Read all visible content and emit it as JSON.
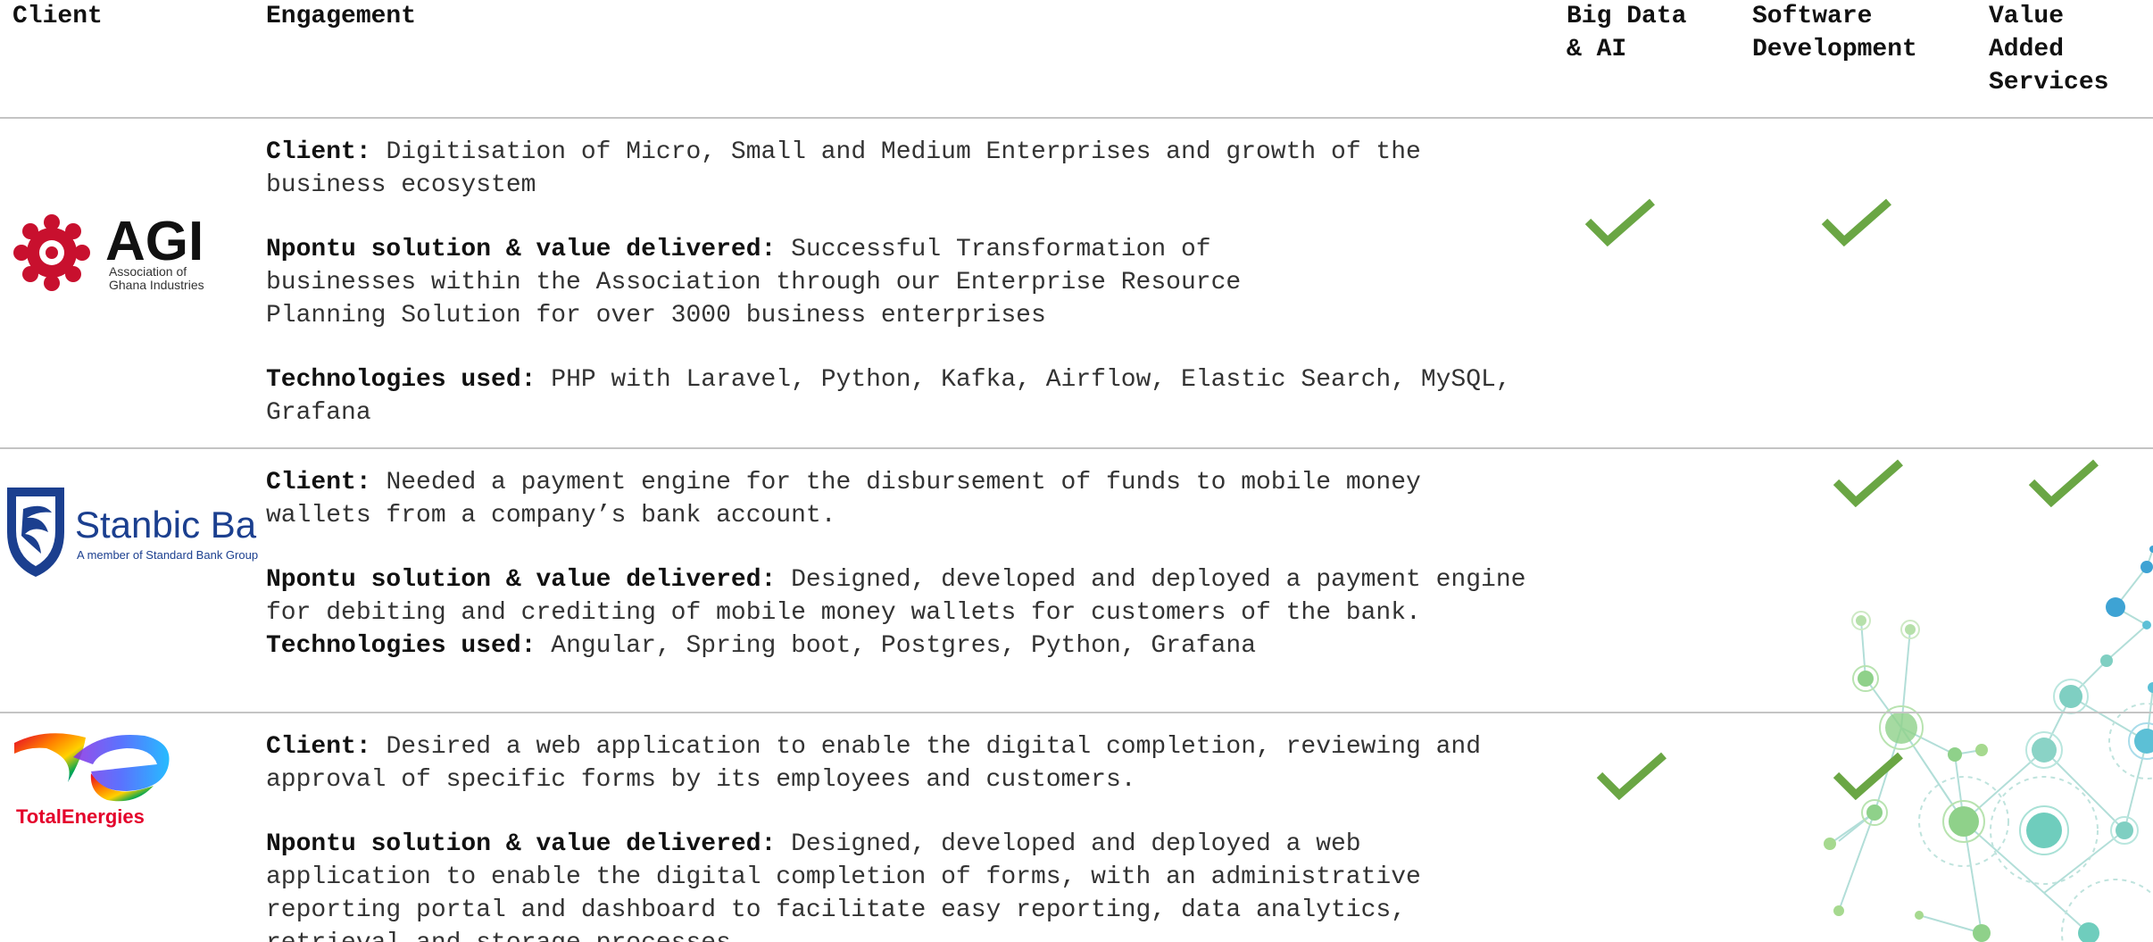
{
  "header": {
    "client": "Client",
    "engagement": "Engagement",
    "big_data_lines": [
      "Big Data",
      "& AI"
    ],
    "software_lines": [
      "Software",
      "Development"
    ],
    "vas_lines": [
      "Value",
      "Added",
      "Services"
    ]
  },
  "colors": {
    "check": "#6aa644",
    "rule": "#c4c4c4",
    "agi_red": "#c8102e",
    "stanbic_blue": "#1b3f8f"
  },
  "rows": [
    {
      "logo": {
        "name": "AGI",
        "subtitle_lines": [
          "Association of",
          "Ghana Industries"
        ]
      },
      "client_label": "Client:",
      "client_text": "Digitisation of Micro, Small and Medium Enterprises and growth of the business ecosystem",
      "solution_label": "Npontu solution & value delivered:",
      "solution_text": "Successful Transformation of businesses within the  Association through our Enterprise Resource Planning Solution for over 3000 business enterprises",
      "tech_label": "Technologies used:",
      "tech_text": "PHP with Laravel, Python, Kafka, Airflow, Elastic Search, MySQL, Grafana",
      "services": {
        "big_data": true,
        "software": true,
        "vas": false
      }
    },
    {
      "logo": {
        "name": "Stanbic Bank",
        "subtitle_lines": [
          "A member of Standard Bank Group"
        ]
      },
      "client_label": "Client:",
      "client_text": "Needed a payment engine for the disbursement of funds to mobile money wallets from a company’s bank account.",
      "solution_label": "Npontu solution & value delivered:",
      "solution_text": "Designed, developed and deployed a payment engine for debiting and crediting of mobile money wallets for customers of the bank.",
      "tech_label": "Technologies used:",
      "tech_text": "Angular, Spring boot, Postgres, Python, Grafana",
      "services": {
        "big_data": false,
        "software": true,
        "vas": true
      }
    },
    {
      "logo": {
        "name": "TotalEnergies",
        "subtitle_lines": []
      },
      "client_label": "Client:",
      "client_text": "Desired a web application to enable the digital completion, reviewing and approval of specific forms by its employees and customers.",
      "solution_label": "Npontu solution & value delivered:",
      "solution_text": "Designed, developed and deployed a web application to enable the digital completion of forms, with an administrative reporting portal and dashboard to facilitate easy reporting, data analytics, retrieval and storage processes.",
      "services": {
        "big_data": true,
        "software": true,
        "vas": false
      }
    }
  ]
}
